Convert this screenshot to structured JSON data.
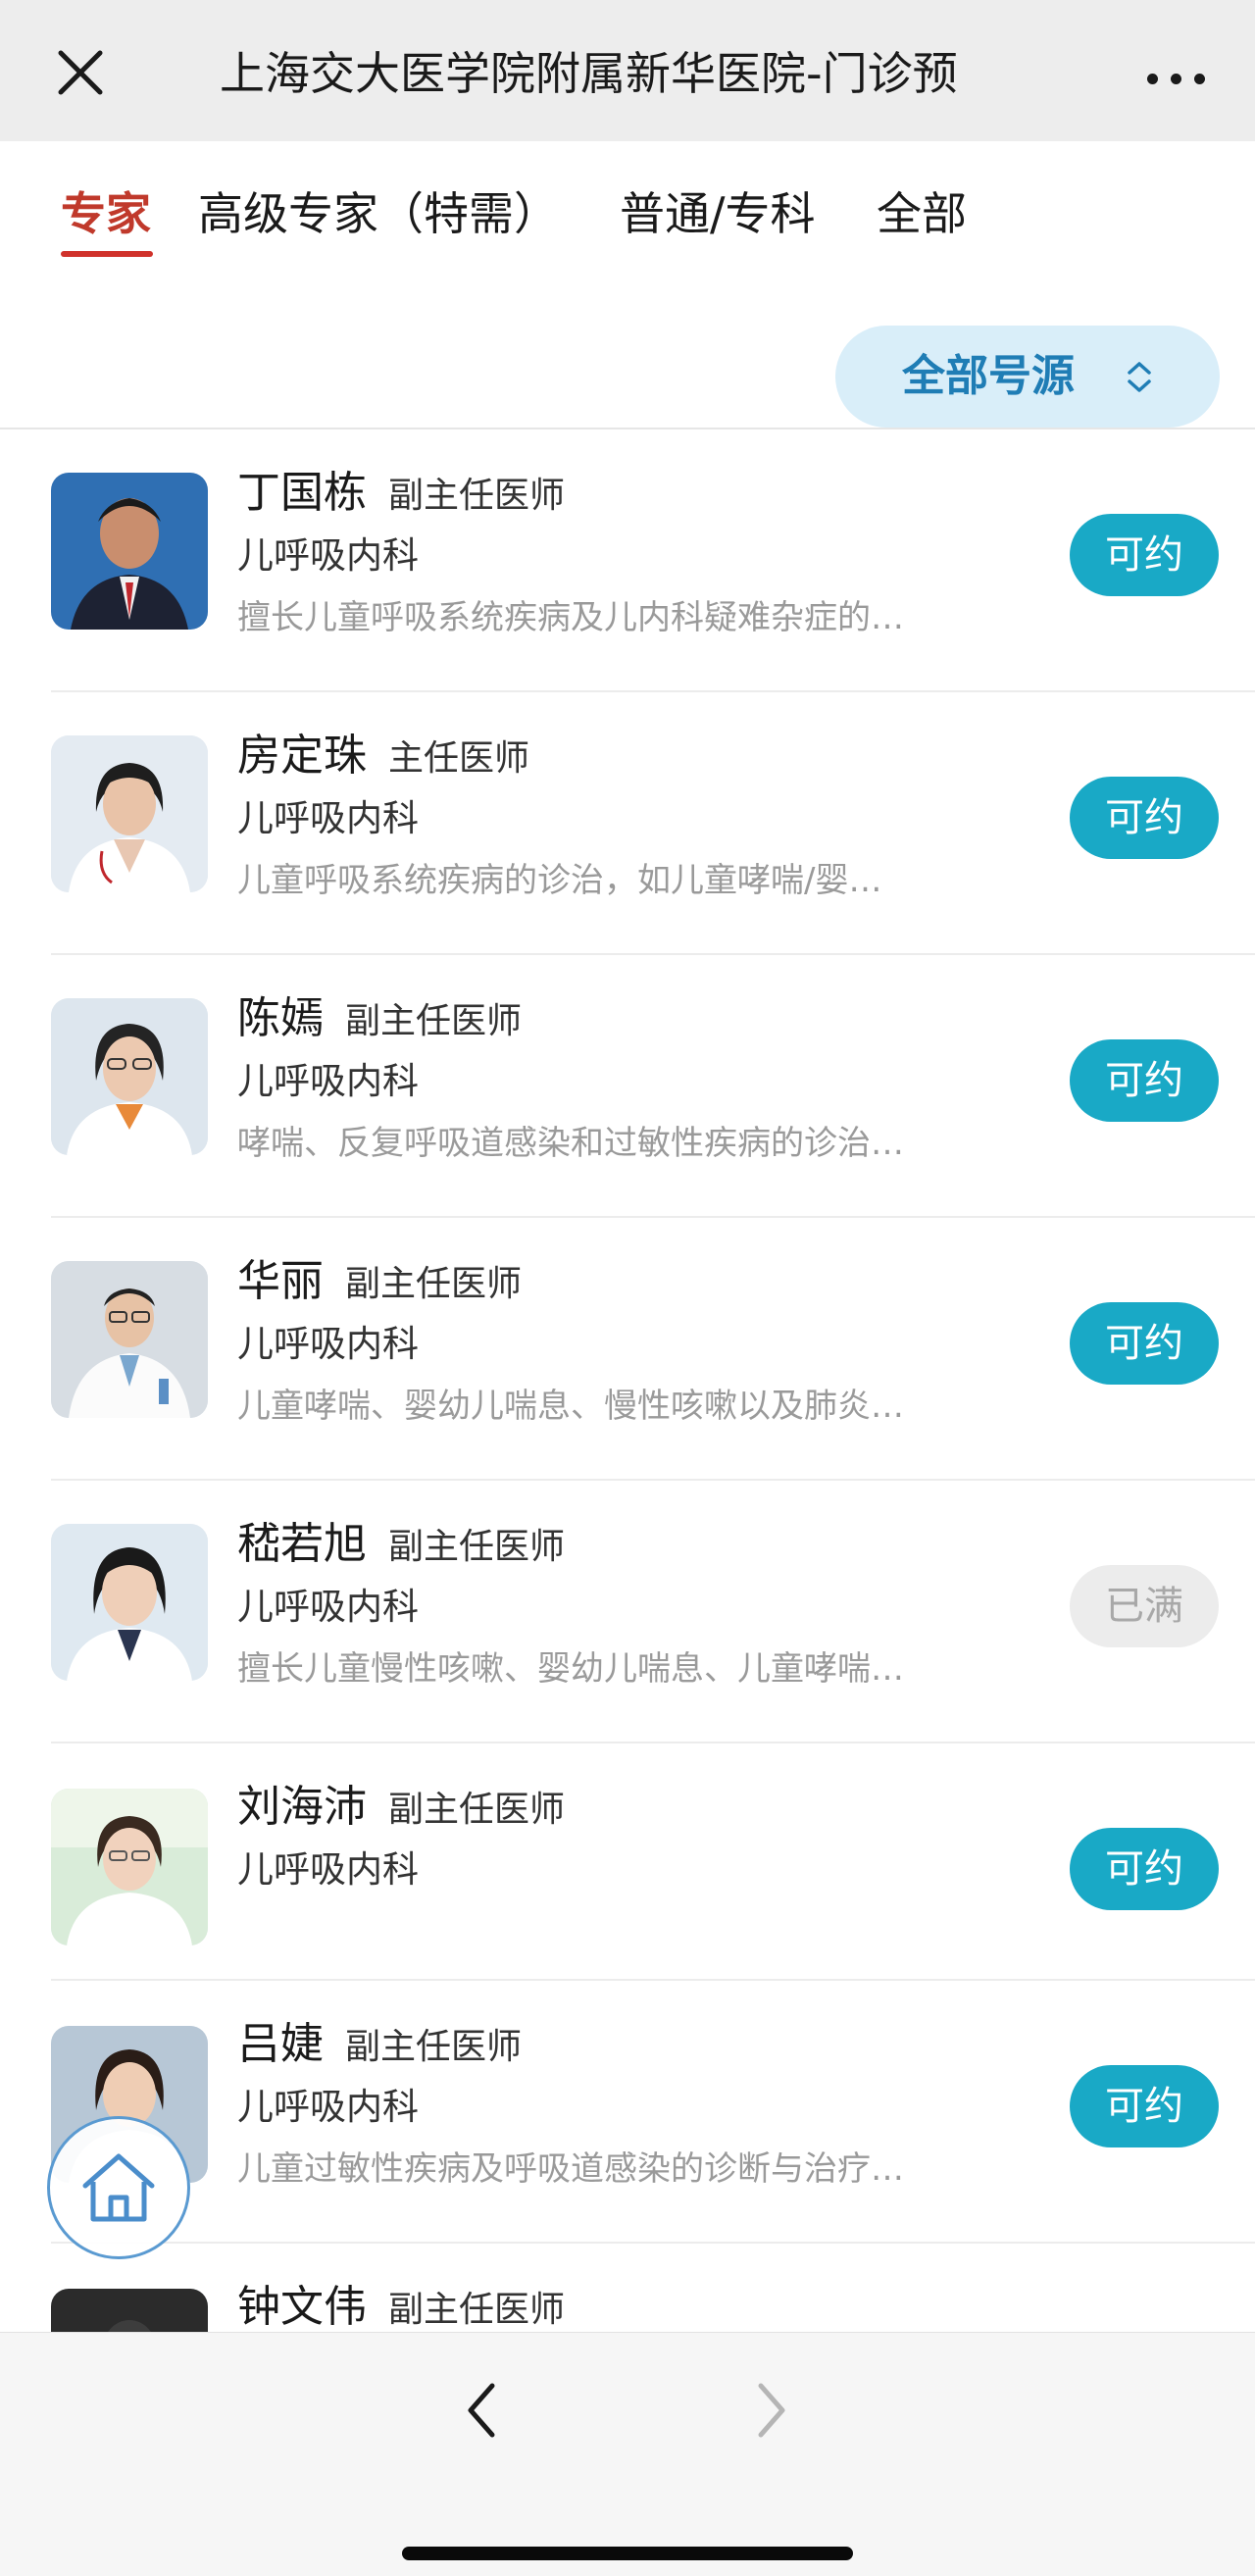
{
  "header": {
    "title": "上海交大医学院附属新华医院-门诊预",
    "close_icon": "close-icon",
    "more_icon": "more-icon"
  },
  "tabs": [
    {
      "label": "专家",
      "active": true
    },
    {
      "label": "高级专家（特需）",
      "active": false
    },
    {
      "label": "普通/专科",
      "active": false
    },
    {
      "label": "全部",
      "active": false
    }
  ],
  "filter": {
    "label": "全部号源",
    "icon": "chevron-updown-icon"
  },
  "doctors": [
    {
      "name": "丁国栋",
      "rank": "副主任医师",
      "dept": "儿呼吸内科",
      "desc": "擅长儿童呼吸系统疾病及儿内科疑难杂症的…",
      "status": "可约",
      "available": true
    },
    {
      "name": "房定珠",
      "rank": "主任医师",
      "dept": "儿呼吸内科",
      "desc": "儿童呼吸系统疾病的诊治，如儿童哮喘/婴…",
      "status": "可约",
      "available": true
    },
    {
      "name": "陈嫣",
      "rank": "副主任医师",
      "dept": "儿呼吸内科",
      "desc": "哮喘、反复呼吸道感染和过敏性疾病的诊治…",
      "status": "可约",
      "available": true
    },
    {
      "name": "华丽",
      "rank": "副主任医师",
      "dept": "儿呼吸内科",
      "desc": "儿童哮喘、婴幼儿喘息、慢性咳嗽以及肺炎…",
      "status": "可约",
      "available": true
    },
    {
      "name": "嵇若旭",
      "rank": "副主任医师",
      "dept": "儿呼吸内科",
      "desc": "擅长儿童慢性咳嗽、婴幼儿喘息、儿童哮喘…",
      "status": "已满",
      "available": false
    },
    {
      "name": "刘海沛",
      "rank": "副主任医师",
      "dept": "儿呼吸内科",
      "desc": "",
      "status": "可约",
      "available": true
    },
    {
      "name": "吕婕",
      "rank": "副主任医师",
      "dept": "儿呼吸内科",
      "desc": "儿童过敏性疾病及呼吸道感染的诊断与治疗…",
      "status": "可约",
      "available": true
    },
    {
      "name": "钟文伟",
      "rank": "副主任医师",
      "dept": "",
      "desc": "",
      "status": "",
      "available": true
    }
  ],
  "colors": {
    "accent": "#19a9c6",
    "active_tab": "#d0322b",
    "filter_bg": "#d9eef9",
    "filter_text": "#1f7db5"
  },
  "bottom_nav": {
    "back_icon": "chevron-left-icon",
    "forward_icon": "chevron-right-icon",
    "home_icon": "home-icon"
  }
}
